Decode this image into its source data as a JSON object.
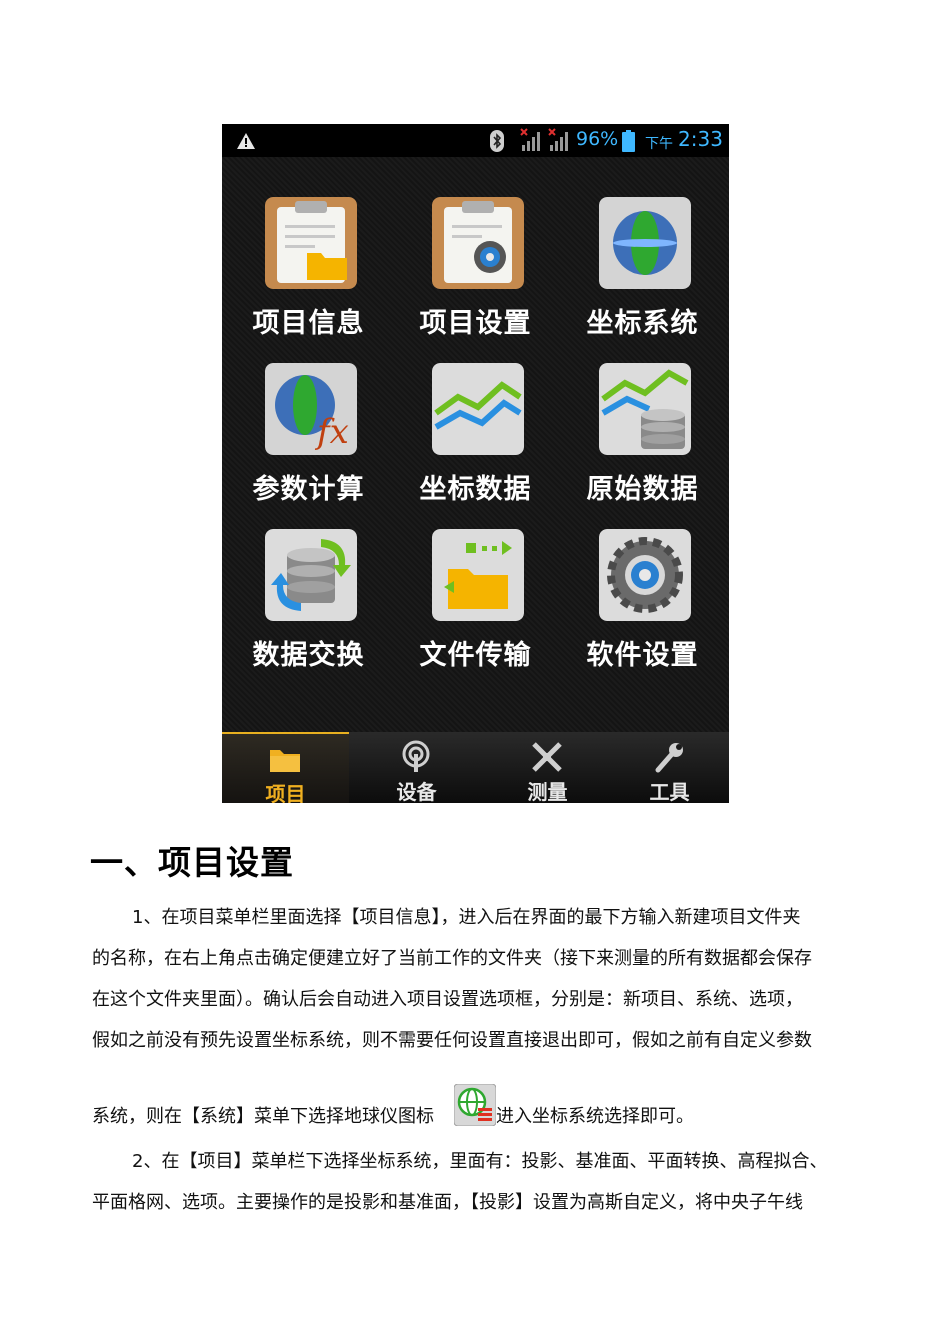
{
  "status_bar": {
    "battery_percent": "96%",
    "am_pm": "下午",
    "time": "2:33"
  },
  "menu_grid": [
    {
      "label": "项目信息",
      "icon": "clipboard-folder-icon"
    },
    {
      "label": "项目设置",
      "icon": "clipboard-gear-icon"
    },
    {
      "label": "坐标系统",
      "icon": "globe-icon"
    },
    {
      "label": "参数计算",
      "icon": "globe-fx-icon"
    },
    {
      "label": "坐标数据",
      "icon": "line-chart-icon"
    },
    {
      "label": "原始数据",
      "icon": "chart-database-icon"
    },
    {
      "label": "数据交换",
      "icon": "database-exchange-icon"
    },
    {
      "label": "文件传输",
      "icon": "folder-transfer-icon"
    },
    {
      "label": "软件设置",
      "icon": "gear-icon"
    }
  ],
  "tabs": [
    {
      "label": "项目",
      "icon": "folder-icon",
      "active": true
    },
    {
      "label": "设备",
      "icon": "antenna-icon",
      "active": false
    },
    {
      "label": "测量",
      "icon": "survey-tools-icon",
      "active": false
    },
    {
      "label": "工具",
      "icon": "wrench-icon",
      "active": false
    }
  ],
  "document": {
    "heading": "一、项目设置",
    "lines": [
      "1、在项目菜单栏里面选择【项目信息】，进入后在界面的最下方输入新建项目文件夹",
      "的名称，在右上角点击确定便建立好了当前工作的文件夹（接下来测量的所有数据都会保存",
      "在这个文件夹里面）。确认后会自动进入项目设置选项框，分别是：新项目、系统、选项，",
      "假如之前没有预先设置坐标系统，则不需要任何设置直接退出即可，假如之前有自定义参数",
      "系统，则在【系统】菜单下选择地球仪图标",
      "进入坐标系统选择即可。",
      "2、在【项目】菜单栏下选择坐标系统，里面有：投影、基准面、平面转换、高程拟合、",
      "平面格网、选项。主要操作的是投影和基准面，【投影】设置为高斯自定义，将中央子午线"
    ],
    "inline_icon": "globe-list-icon"
  }
}
